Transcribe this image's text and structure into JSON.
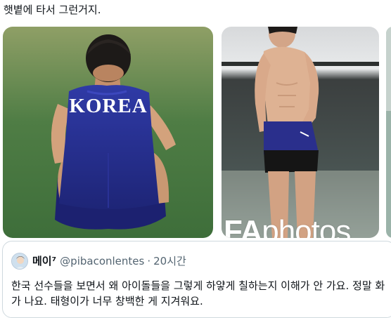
{
  "tweet": {
    "text": "햇볕에 타서 그런거지."
  },
  "media": {
    "photo1_shirt_text": "KOREA",
    "watermark_bold": "FA",
    "watermark_rest": "photos"
  },
  "quote": {
    "name": "메이⁷",
    "handle": "@pibaconlentes",
    "separator": "·",
    "time": "20시간",
    "text": "한국 선수들을 보면서 왜 아이돌들을 그렇게 하얗게 칠하는지 이해가 안 가요. 정말 화가 나요. 태형이가 너무 창백한 게 지겨워요."
  }
}
